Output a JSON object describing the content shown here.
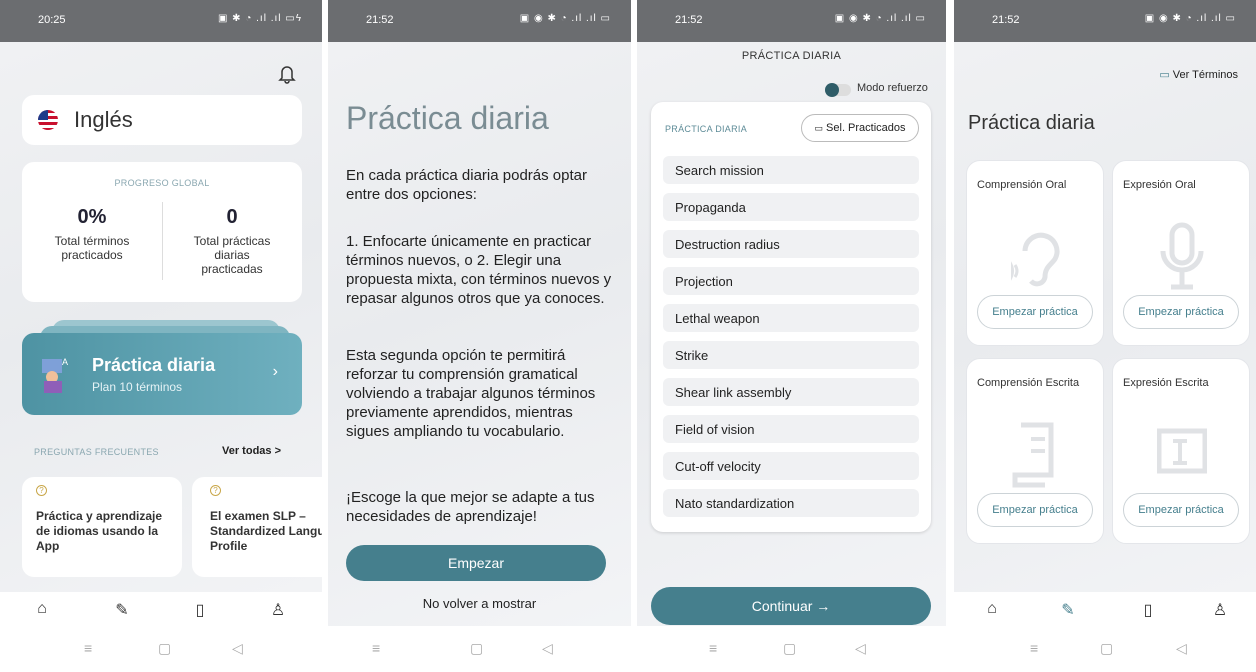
{
  "screen1": {
    "time": "20:25",
    "status_icons": "▣ ✱ ◔ .ıl .ıl ▭ϟ",
    "language": "Inglés",
    "progress_title": "PROGRESO GLOBAL",
    "stat1_value": "0%",
    "stat1_label": "Total términos practicados",
    "stat2_value": "0",
    "stat2_label": "Total prácticas diarias practicadas",
    "daily_title": "Práctica diaria",
    "daily_sub": "Plan 10 términos",
    "faq_title": "PREGUNTAS FRECUENTES",
    "faq_link": "Ver todas >",
    "faq_cards": [
      {
        "title": "Práctica y aprendizaje de idiomas usando la App"
      },
      {
        "title": "El examen SLP – Standardized Language Profile"
      }
    ]
  },
  "screen2": {
    "time": "21:52",
    "status_icons": "▣ ◉ ✱ ◔ .ıl .ıl ▭",
    "title": "Práctica diaria",
    "para1": "En cada práctica diaria podrás optar entre dos opciones:",
    "para2": "1. Enfocarte únicamente en practicar términos nuevos, o 2. Elegir una propuesta mixta, con términos nuevos y repasar algunos otros que ya conoces.",
    "para3": "Esta segunda opción te permitirá reforzar tu comprensión gramatical volviendo a trabajar algunos términos previamente aprendidos, mientras sigues ampliando tu vocabulario.",
    "para4": "¡Escoge la que mejor se adapte a tus necesidades de aprendizaje!",
    "start_label": "Empezar",
    "dont_show_label": "No volver a mostrar"
  },
  "screen3": {
    "time": "21:52",
    "status_icons": "▣ ◉ ✱ ◔ .ıl .ıl ▭",
    "header": "PRÁCTICA DIARIA",
    "toggle_label": "Modo refuerzo",
    "section_label": "PRÁCTICA DIARIA",
    "select_label": "Sel. Practicados",
    "terms": [
      "Search mission",
      "Propaganda",
      "Destruction radius",
      "Projection",
      "Lethal weapon",
      "Strike",
      "Shear link assembly",
      "Field of vision",
      "Cut-off velocity",
      "Nato standardization"
    ],
    "continue_label": "Continuar →"
  },
  "screen4": {
    "time": "21:52",
    "status_icons": "▣ ◉ ✱ ◔ .ıl .ıl ▭",
    "view_terms_label": "Ver Términos",
    "title": "Práctica diaria",
    "skills": [
      {
        "title": "Comprensión Oral",
        "button": "Empezar práctica"
      },
      {
        "title": "Expresión Oral",
        "button": "Empezar práctica"
      },
      {
        "title": "Comprensión Escrita",
        "button": "Empezar práctica"
      },
      {
        "title": "Expresión Escrita",
        "button": "Empezar práctica"
      }
    ]
  },
  "colors": {
    "accent": "#457f8d",
    "card_gradient_start": "#4e93a3",
    "card_gradient_end": "#6fb0bf"
  }
}
